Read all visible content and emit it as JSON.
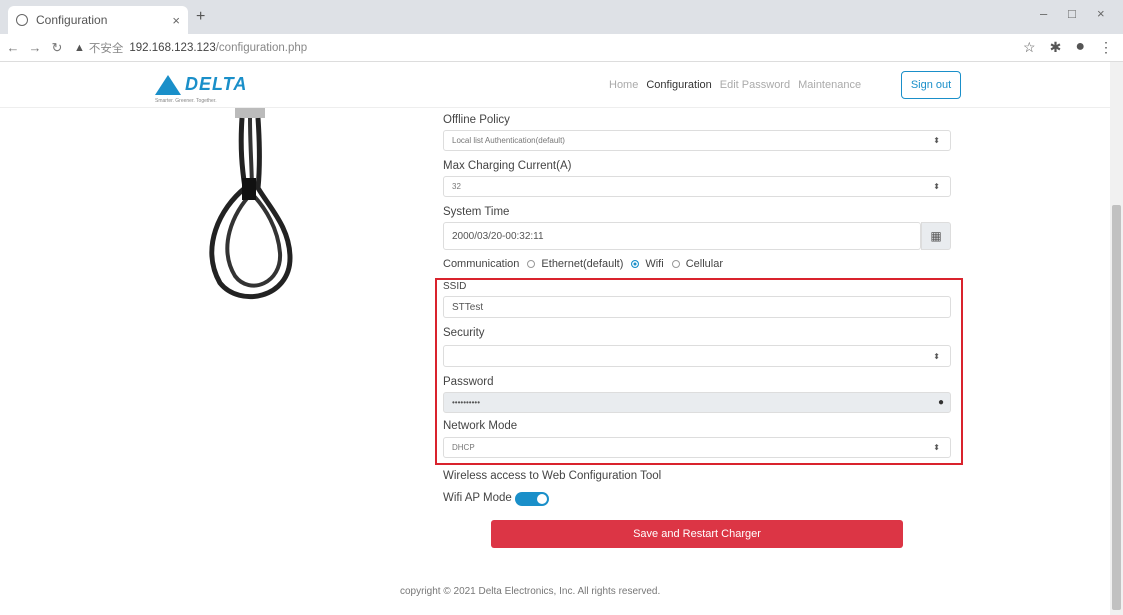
{
  "browser": {
    "tab_title": "Configuration",
    "tab_close": "×",
    "new_tab": "+",
    "url_warning": "不安全",
    "url_host": "192.168.123.123",
    "url_path": "/configuration.php",
    "win_min": "–",
    "win_max": "□",
    "win_close": "×"
  },
  "header": {
    "logo_text": "DELTA",
    "logo_tagline": "Smarter. Greener. Together.",
    "menu": [
      "Home",
      "Configuration",
      "Edit Password",
      "Maintenance"
    ],
    "signout_label": "Sign out"
  },
  "form": {
    "offline_policy_label": "Offline Policy",
    "offline_policy_value": "Local list Authentication(default)",
    "max_current_label": "Max Charging Current(A)",
    "max_current_value": "32",
    "system_time_label": "System Time",
    "system_time_value": "2000/03/20-00:32:11",
    "communication_label": "Communication",
    "comm_options": [
      "Ethernet(default)",
      "Wifi",
      "Cellular"
    ],
    "comm_selected": "Wifi",
    "ssid_label": "SSID",
    "ssid_value": "STTest",
    "security_label": "Security",
    "security_value": "",
    "password_label": "Password",
    "password_value": "••••••••••",
    "network_mode_label": "Network Mode",
    "network_mode_value": "DHCP",
    "wireless_access_label": "Wireless access to Web Configuration Tool",
    "wifi_ap_label": "Wifi AP Mode",
    "wifi_ap_on": true,
    "save_label": "Save and Restart Charger"
  },
  "footer": {
    "copyright": "copyright © 2021 Delta Electronics, Inc.   All rights reserved."
  },
  "colors": {
    "accent": "#1a8fc9",
    "danger": "#dc3545",
    "highlight_border": "#d9232d"
  }
}
